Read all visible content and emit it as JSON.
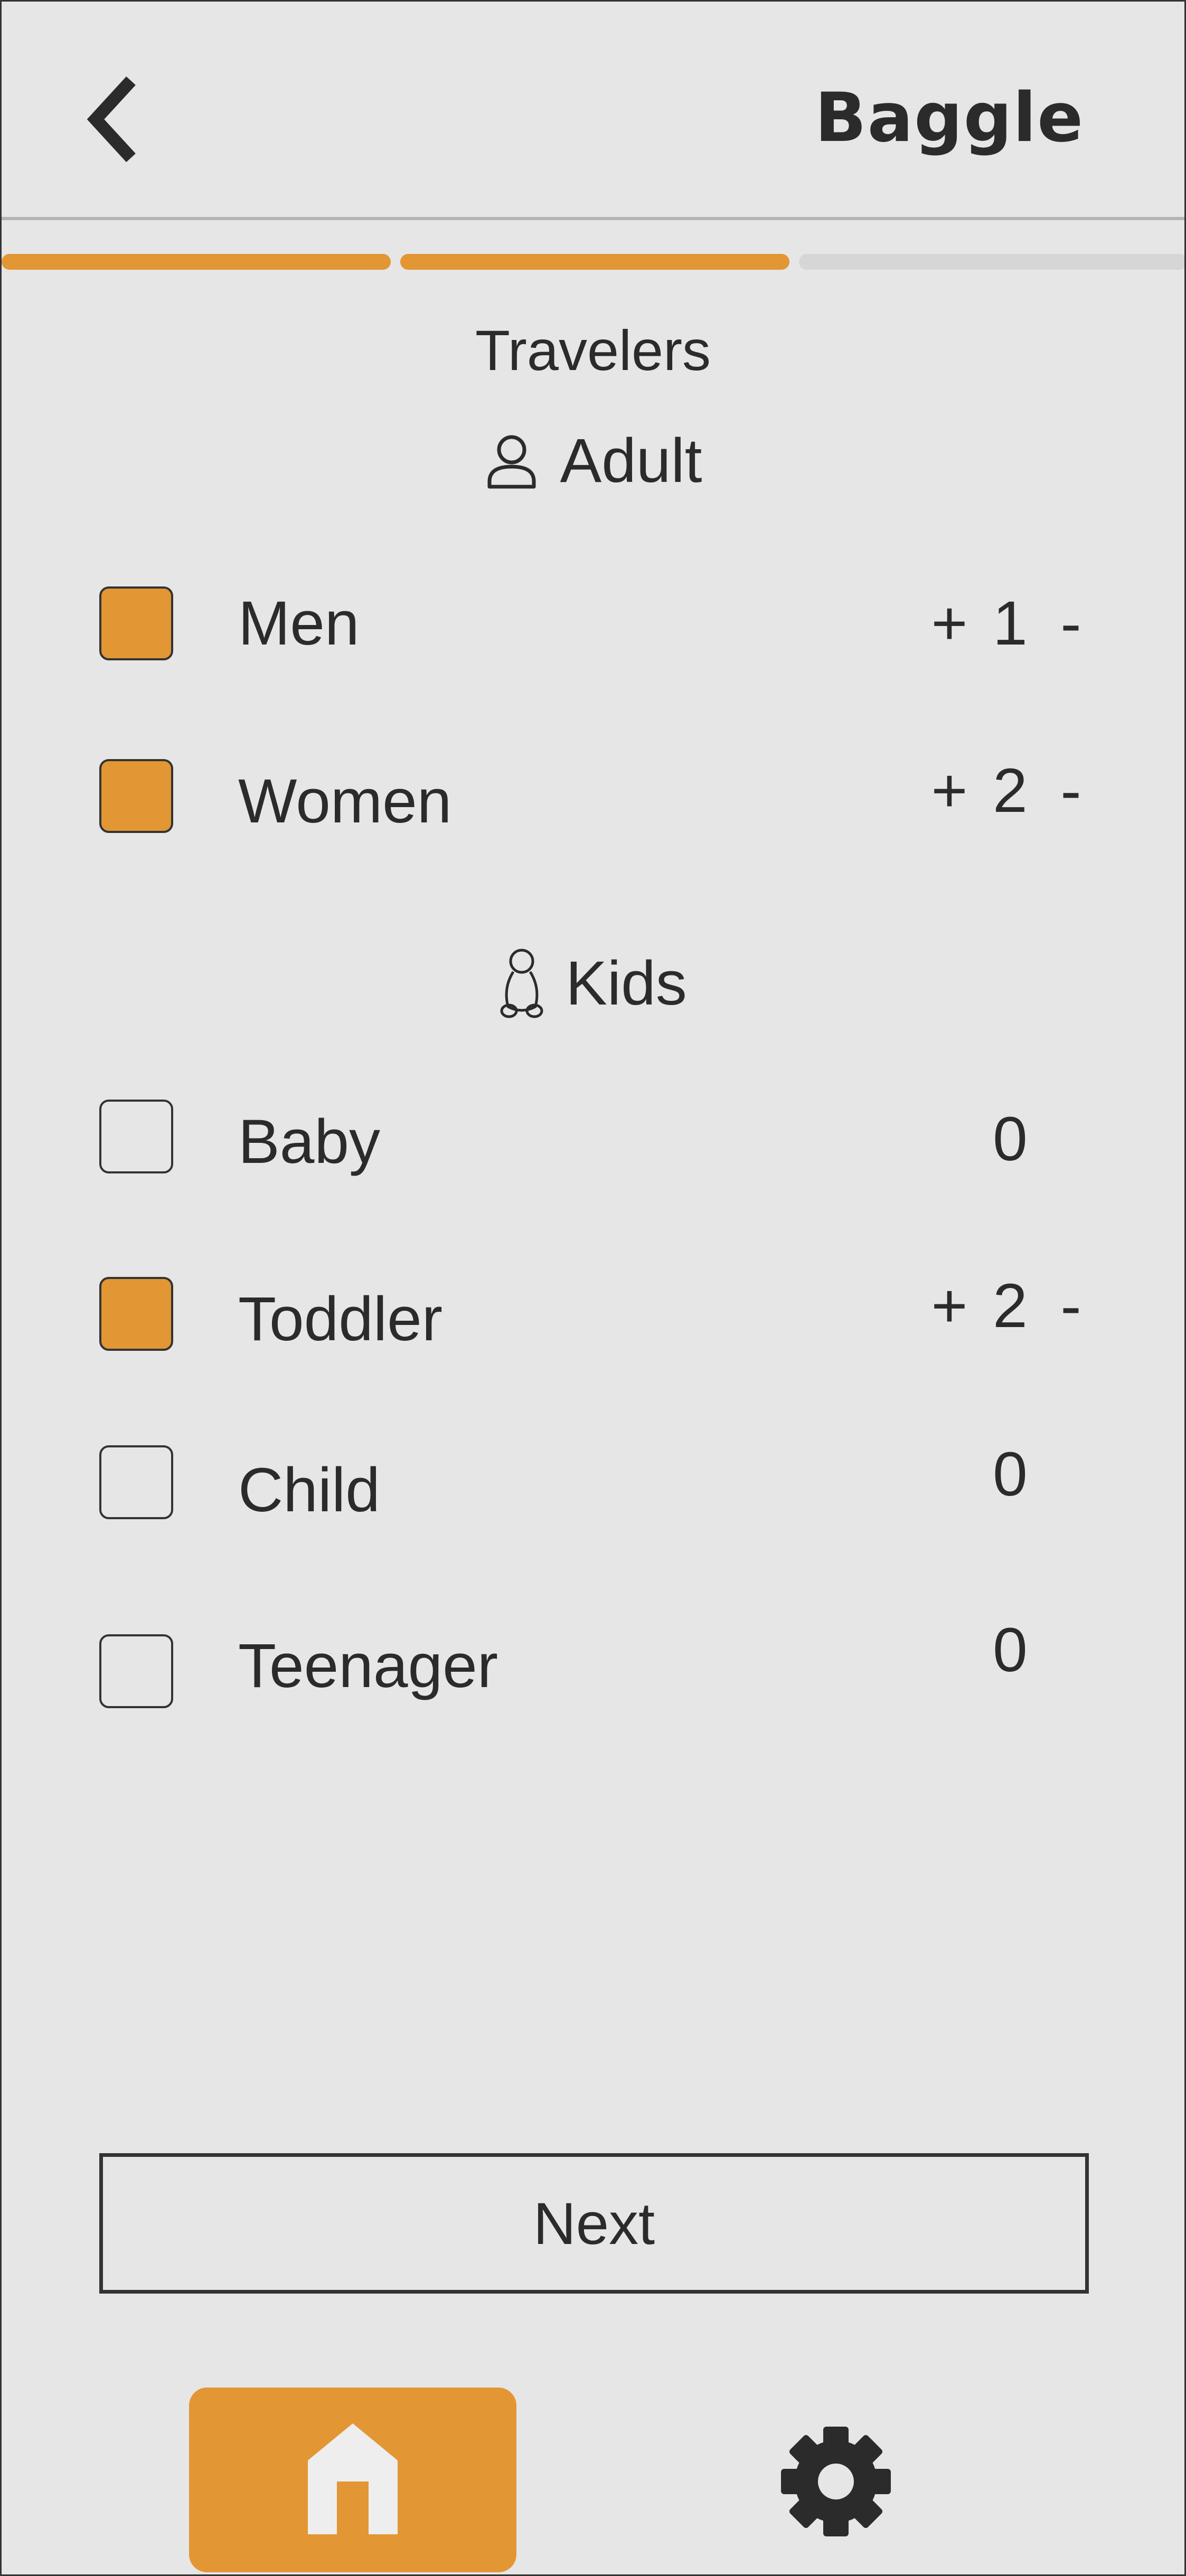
{
  "header": {
    "title": "Baggle",
    "back_icon": "chevron-left-icon"
  },
  "progress": {
    "total_steps": 3,
    "completed_steps": 2,
    "active_color": "#e29634",
    "inactive_color": "#d6d6d6"
  },
  "page": {
    "title": "Travelers"
  },
  "adult": {
    "label": "Adult",
    "icon": "person-icon",
    "items": [
      {
        "label": "Men",
        "checked": true,
        "count": "1",
        "plus": "+",
        "minus": "-"
      },
      {
        "label": "Women",
        "checked": true,
        "count": "2",
        "plus": "+",
        "minus": "-"
      }
    ]
  },
  "kids": {
    "label": "Kids",
    "icon": "baby-icon",
    "items": [
      {
        "label": "Baby",
        "checked": false,
        "count": "0"
      },
      {
        "label": "Toddler",
        "checked": true,
        "count": "2",
        "plus": "+",
        "minus": "-"
      },
      {
        "label": "Child",
        "checked": false,
        "count": "0"
      },
      {
        "label": "Teenager",
        "checked": false,
        "count": "0"
      }
    ]
  },
  "actions": {
    "next_label": "Next"
  },
  "nav": {
    "home_icon": "home-icon",
    "settings_icon": "gear-icon",
    "active_color": "#e29634"
  },
  "colors": {
    "accent": "#e29634",
    "background": "#e6e6e6",
    "text": "#2b2b2b"
  }
}
